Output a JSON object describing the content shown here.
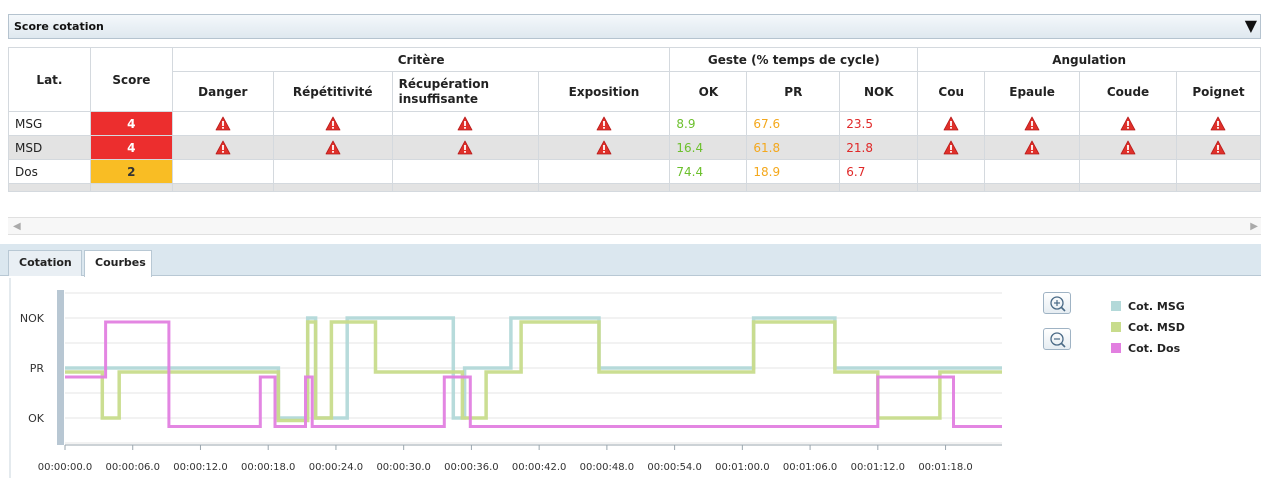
{
  "panel": {
    "title": "Score cotation",
    "toggle_icon": "triangle-down-icon"
  },
  "table": {
    "group_headers": {
      "critere": "Critère",
      "geste": "Geste (% temps de cycle)",
      "angulation": "Angulation"
    },
    "headers": {
      "lat": "Lat.",
      "score": "Score",
      "danger": "Danger",
      "repetitivite": "Répétitivité",
      "recuperation_1": "Récupération",
      "recuperation_2": "insuffisante",
      "exposition": "Exposition",
      "ok": "OK",
      "pr": "PR",
      "nok": "NOK",
      "cou": "Cou",
      "epaule": "Epaule",
      "coude": "Coude",
      "poignet": "Poignet"
    },
    "rows": [
      {
        "lat": "MSG",
        "score": "4",
        "score_level": "red",
        "ok": "8.9",
        "pr": "67.6",
        "nok": "23.5"
      },
      {
        "lat": "MSD",
        "score": "4",
        "score_level": "red",
        "ok": "16.4",
        "pr": "61.8",
        "nok": "21.8"
      },
      {
        "lat": "Dos",
        "score": "2",
        "score_level": "orange",
        "ok": "74.4",
        "pr": "18.9",
        "nok": "6.7"
      }
    ],
    "warning_icon": "warning-triangle-icon"
  },
  "tabs": [
    {
      "label": "Cotation",
      "active": false
    },
    {
      "label": "Courbes",
      "active": true
    }
  ],
  "chart_data": {
    "type": "line",
    "x_unit": "seconds",
    "y_ticks": [
      "OK",
      "PR",
      "NOK"
    ],
    "x_ticks": [
      "00:00:00.0",
      "00:00:06.0",
      "00:00:12.0",
      "00:00:18.0",
      "00:00:24.0",
      "00:00:30.0",
      "00:00:36.0",
      "00:00:42.0",
      "00:00:48.0",
      "00:00:54.0",
      "00:01:00.0",
      "00:01:06.0",
      "00:01:12.0",
      "00:01:18.0"
    ],
    "xlim": [
      0,
      83
    ],
    "series": [
      {
        "name": "Cot. MSG",
        "color": "#b3d9d9",
        "points": [
          [
            0,
            1
          ],
          [
            18.9,
            1
          ],
          [
            18.9,
            0
          ],
          [
            21.5,
            0
          ],
          [
            21.5,
            2
          ],
          [
            22.2,
            2
          ],
          [
            22.2,
            0
          ],
          [
            25,
            0
          ],
          [
            25,
            2
          ],
          [
            34.4,
            2
          ],
          [
            34.4,
            0
          ],
          [
            35.4,
            0
          ],
          [
            35.4,
            1
          ],
          [
            39.5,
            1
          ],
          [
            39.5,
            2
          ],
          [
            47.3,
            2
          ],
          [
            47.3,
            1
          ],
          [
            61,
            1
          ],
          [
            61,
            2
          ],
          [
            68.2,
            2
          ],
          [
            68.2,
            1
          ],
          [
            83,
            1
          ]
        ]
      },
      {
        "name": "Cot. MSD",
        "color": "#c8dc8c",
        "points": [
          [
            0,
            0.92
          ],
          [
            3.3,
            0.92
          ],
          [
            3.3,
            0
          ],
          [
            4.8,
            0
          ],
          [
            4.8,
            0.92
          ],
          [
            18.9,
            0.92
          ],
          [
            18.9,
            -0.05
          ],
          [
            21.5,
            -0.05
          ],
          [
            21.5,
            1.92
          ],
          [
            22.2,
            1.92
          ],
          [
            22.2,
            0
          ],
          [
            23.6,
            0
          ],
          [
            23.6,
            1.92
          ],
          [
            27.5,
            1.92
          ],
          [
            27.5,
            0.92
          ],
          [
            35.2,
            0.92
          ],
          [
            35.2,
            0
          ],
          [
            37.3,
            0
          ],
          [
            37.3,
            0.92
          ],
          [
            40.4,
            0.92
          ],
          [
            40.4,
            1.92
          ],
          [
            47.3,
            1.92
          ],
          [
            47.3,
            0.92
          ],
          [
            61,
            0.92
          ],
          [
            61,
            1.92
          ],
          [
            68.2,
            1.92
          ],
          [
            68.2,
            0.92
          ],
          [
            72,
            0.92
          ],
          [
            72,
            0
          ],
          [
            77.5,
            0
          ],
          [
            77.5,
            0.92
          ],
          [
            83,
            0.92
          ]
        ]
      },
      {
        "name": "Cot. Dos",
        "color": "#e27fe0",
        "points": [
          [
            0,
            0.82
          ],
          [
            3.6,
            0.82
          ],
          [
            3.6,
            1.92
          ],
          [
            9.2,
            1.92
          ],
          [
            9.2,
            -0.17
          ],
          [
            17.3,
            -0.17
          ],
          [
            17.3,
            0.82
          ],
          [
            18.6,
            0.82
          ],
          [
            18.6,
            -0.17
          ],
          [
            21.3,
            -0.17
          ],
          [
            21.3,
            0.82
          ],
          [
            21.9,
            0.82
          ],
          [
            21.9,
            -0.17
          ],
          [
            33.6,
            -0.17
          ],
          [
            33.6,
            0.82
          ],
          [
            35.9,
            0.82
          ],
          [
            35.9,
            -0.17
          ],
          [
            72,
            -0.17
          ],
          [
            72,
            0.82
          ],
          [
            78.7,
            0.82
          ],
          [
            78.7,
            -0.17
          ],
          [
            83,
            -0.17
          ]
        ]
      }
    ]
  }
}
